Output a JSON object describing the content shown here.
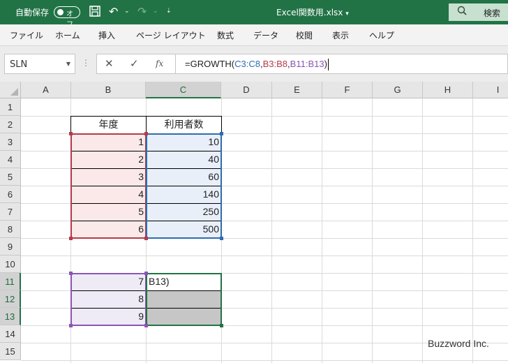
{
  "titlebar": {
    "autosave_label": "自動保存",
    "autosave_toggle": "オフ",
    "filename": "Excel関数用.xlsx",
    "filename_dropdown": "▾",
    "search_label": "検索",
    "save_icon": "▯",
    "undo_icon": "↶",
    "redo_icon": "↷",
    "dropdown_glyph": "⌄",
    "customize_icon": "⇣",
    "accent_color": "#217346"
  },
  "ribbon": {
    "tabs": [
      "ファイル",
      "ホーム",
      "挿入",
      "ページ レイアウト",
      "数式",
      "データ",
      "校閲",
      "表示",
      "ヘルプ"
    ]
  },
  "formula_bar": {
    "name_box": "SLN",
    "cancel_icon": "✕",
    "enter_icon": "✓",
    "fx_label": "fx",
    "formula_parts": [
      {
        "text": "=GROWTH(",
        "color": "#222222"
      },
      {
        "text": "C3:C8",
        "color": "#2f6cb1"
      },
      {
        "text": ",",
        "color": "#222222"
      },
      {
        "text": "B3:B8",
        "color": "#b33b4a"
      },
      {
        "text": ",",
        "color": "#222222"
      },
      {
        "text": "B11:B13",
        "color": "#8a55b5"
      },
      {
        "text": ")",
        "color": "#222222"
      }
    ]
  },
  "sheet": {
    "columns": [
      "A",
      "B",
      "C",
      "D",
      "E",
      "F",
      "G",
      "H",
      "I"
    ],
    "rows": [
      "1",
      "2",
      "3",
      "4",
      "5",
      "6",
      "7",
      "8",
      "9",
      "10",
      "11",
      "12",
      "13",
      "14",
      "15"
    ],
    "selected_column": "C",
    "selected_rows": [
      "11",
      "12",
      "13"
    ],
    "headers": {
      "b2": "年度",
      "c2": "利用者数"
    },
    "table": [
      {
        "year": "1",
        "users": "10"
      },
      {
        "year": "2",
        "users": "40"
      },
      {
        "year": "3",
        "users": "60"
      },
      {
        "year": "4",
        "users": "140"
      },
      {
        "year": "5",
        "users": "250"
      },
      {
        "year": "6",
        "users": "500"
      }
    ],
    "new_years": [
      "7",
      "8",
      "9"
    ],
    "editing_cell_text": "B13)",
    "range_colors": {
      "known_x": "#b33b4a",
      "known_y": "#2f6cb1",
      "new_x": "#8a55b5"
    }
  },
  "watermark": "Buzzword Inc."
}
